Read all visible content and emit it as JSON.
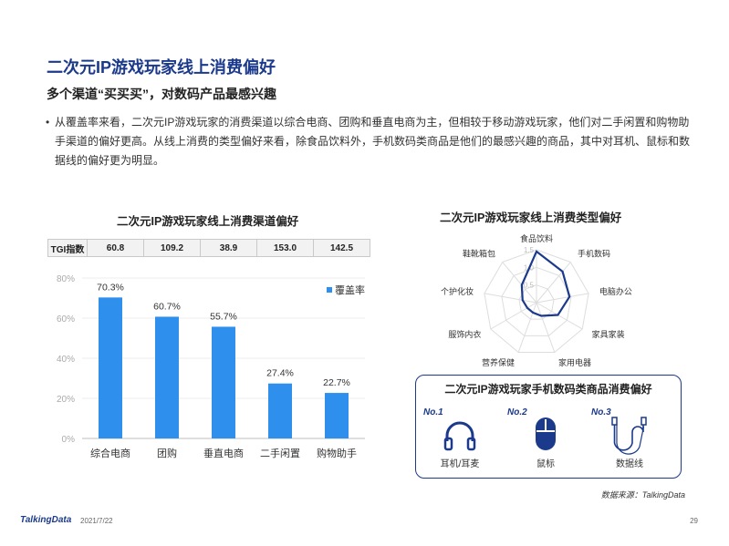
{
  "page": {
    "title": "二次元IP游戏玩家线上消费偏好",
    "subtitle": "多个渠道“买买买”，对数码产品最感兴趣",
    "bullet": "从覆盖率来看，二次元IP游戏玩家的消费渠道以综合电商、团购和垂直电商为主，但相较于移动游戏玩家，他们对二手闲置和购物助手渠道的偏好更高。从线上消费的类型偏好来看，除食品饮料外，手机数码类商品是他们的最感兴趣的商品，其中对耳机、鼠标和数据线的偏好更为明显。",
    "source": "数据来源：TalkingData",
    "logo": "TalkingData",
    "date": "2021/7/22",
    "page_number": "29"
  },
  "colors": {
    "accent": "#1b3a8c",
    "bar": "#2f8fec",
    "radar": "#1b3a8c"
  },
  "chart_data": [
    {
      "type": "bar",
      "title": "二次元IP游戏玩家线上消费渠道偏好",
      "categories": [
        "综合电商",
        "团购",
        "垂直电商",
        "二手闲置",
        "购物助手"
      ],
      "series": [
        {
          "name": "覆盖率",
          "values": [
            70.3,
            60.7,
            55.7,
            27.4,
            22.7
          ]
        }
      ],
      "data_labels": [
        "70.3%",
        "60.7%",
        "55.7%",
        "27.4%",
        "22.7%"
      ],
      "ylim": [
        0,
        80
      ],
      "yticks": [
        0,
        20,
        40,
        60,
        80
      ],
      "ytick_labels": [
        "0%",
        "20%",
        "40%",
        "60%",
        "80%"
      ],
      "legend": "top-right",
      "tgi": {
        "label": "TGI指数",
        "values": [
          "60.8",
          "109.2",
          "38.9",
          "153.0",
          "142.5"
        ]
      }
    },
    {
      "type": "radar",
      "title": "二次元IP游戏玩家线上消费类型偏好",
      "categories": [
        "食品饮料",
        "手机数码",
        "电脑办公",
        "家具家装",
        "家用电器",
        "营养保健",
        "服饰内衣",
        "个护化妆",
        "鞋靴箱包"
      ],
      "values": [
        1.45,
        1.15,
        0.95,
        0.7,
        0.4,
        0.3,
        0.3,
        0.4,
        0.65
      ],
      "rlim": [
        0,
        1.5
      ],
      "rticks": [
        0.5,
        1.0,
        1.5
      ],
      "rtick_labels": [
        "0.5",
        "1.0",
        "1.5"
      ]
    },
    {
      "type": "table",
      "title": "二次元IP游戏玩家手机数码类商品消费偏好",
      "items": [
        {
          "rank": "No.1",
          "label": "耳机/耳麦",
          "icon": "headphones-icon"
        },
        {
          "rank": "No.2",
          "label": "鼠标",
          "icon": "mouse-icon"
        },
        {
          "rank": "No.3",
          "label": "数据线",
          "icon": "cable-icon"
        }
      ]
    }
  ]
}
